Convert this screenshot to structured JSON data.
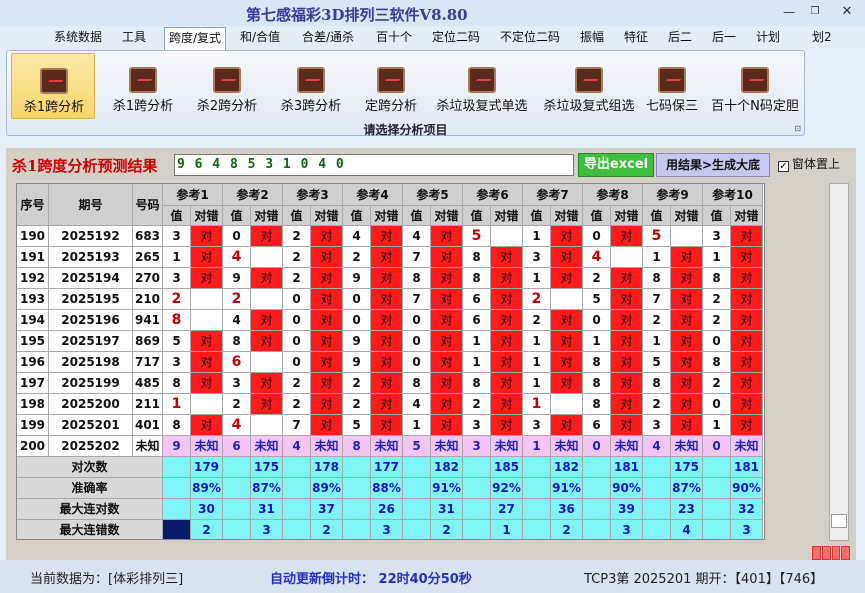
{
  "app": {
    "title": "第七感福彩3D排列三软件V8.80"
  },
  "menu": [
    "系统数据",
    "工具",
    "跨度/复式",
    "和/合值",
    "合差/通杀",
    "百十个",
    "定位二码",
    "不定位二码",
    "振幅",
    "特征",
    "后二",
    "后一",
    "计划",
    "划2"
  ],
  "menu_active": 2,
  "ribbon": {
    "tools": [
      "杀1跨分析",
      "杀1跨分析",
      "杀2跨分析",
      "杀3跨分析",
      "定跨分析",
      "杀垃圾复式单选",
      "杀垃圾复式组选",
      "七码保三",
      "百十个N码定胆"
    ],
    "selected": 0,
    "group_label": "请选择分析项目",
    "icon": "chart-icon"
  },
  "panel": {
    "heading": "杀1跨度分析预测结果",
    "result": "9 6 4 8 5 3 1 0 4 0",
    "export_button": "导出excel",
    "generate_button": "用结果>生成大底",
    "on_top_label": "窗体置上",
    "on_top_checked": true,
    "on_top_mark": "✓"
  },
  "table": {
    "col_seq": "序号",
    "col_period": "期号",
    "col_number": "号码",
    "refs": [
      "参考1",
      "参考2",
      "参考3",
      "参考4",
      "参考5",
      "参考6",
      "参考7",
      "参考8",
      "参考9",
      "参考10"
    ],
    "sub_val": "值",
    "sub_hit": "对错",
    "hit_text": "对",
    "rows": [
      {
        "seq": "190",
        "period": "2025192",
        "num": "683",
        "vals": [
          "3",
          "0",
          "2",
          "4",
          "4",
          "5",
          "1",
          "0",
          "5",
          "3"
        ],
        "hit": [
          1,
          1,
          1,
          1,
          1,
          0,
          1,
          1,
          0,
          1
        ]
      },
      {
        "seq": "191",
        "period": "2025193",
        "num": "265",
        "vals": [
          "1",
          "4",
          "2",
          "2",
          "7",
          "8",
          "3",
          "4",
          "1",
          "1"
        ],
        "hit": [
          1,
          0,
          1,
          1,
          1,
          1,
          1,
          0,
          1,
          1
        ]
      },
      {
        "seq": "192",
        "period": "2025194",
        "num": "270",
        "vals": [
          "3",
          "9",
          "2",
          "9",
          "8",
          "8",
          "1",
          "2",
          "8",
          "8"
        ],
        "hit": [
          1,
          1,
          1,
          1,
          1,
          1,
          1,
          1,
          1,
          1
        ]
      },
      {
        "seq": "193",
        "period": "2025195",
        "num": "210",
        "vals": [
          "2",
          "2",
          "0",
          "0",
          "7",
          "6",
          "2",
          "5",
          "7",
          "2"
        ],
        "hit": [
          0,
          0,
          1,
          1,
          1,
          1,
          0,
          1,
          1,
          1
        ]
      },
      {
        "seq": "194",
        "period": "2025196",
        "num": "941",
        "vals": [
          "8",
          "4",
          "0",
          "0",
          "0",
          "6",
          "2",
          "0",
          "2",
          "2"
        ],
        "hit": [
          0,
          1,
          1,
          1,
          1,
          1,
          1,
          1,
          1,
          1
        ]
      },
      {
        "seq": "195",
        "period": "2025197",
        "num": "869",
        "vals": [
          "5",
          "8",
          "0",
          "9",
          "0",
          "1",
          "1",
          "1",
          "1",
          "0"
        ],
        "hit": [
          1,
          1,
          1,
          1,
          1,
          1,
          1,
          1,
          1,
          1
        ]
      },
      {
        "seq": "196",
        "period": "2025198",
        "num": "717",
        "vals": [
          "3",
          "6",
          "0",
          "9",
          "0",
          "1",
          "1",
          "8",
          "5",
          "8"
        ],
        "hit": [
          1,
          0,
          1,
          1,
          1,
          1,
          1,
          1,
          1,
          1
        ]
      },
      {
        "seq": "197",
        "period": "2025199",
        "num": "485",
        "vals": [
          "8",
          "3",
          "2",
          "2",
          "8",
          "8",
          "1",
          "8",
          "8",
          "2"
        ],
        "hit": [
          1,
          1,
          1,
          1,
          1,
          1,
          1,
          1,
          1,
          1
        ]
      },
      {
        "seq": "198",
        "period": "2025200",
        "num": "211",
        "vals": [
          "1",
          "2",
          "2",
          "2",
          "4",
          "2",
          "1",
          "8",
          "2",
          "0"
        ],
        "hit": [
          0,
          1,
          1,
          1,
          1,
          1,
          0,
          1,
          1,
          1
        ]
      },
      {
        "seq": "199",
        "period": "2025201",
        "num": "401",
        "vals": [
          "8",
          "4",
          "7",
          "5",
          "1",
          "3",
          "3",
          "6",
          "3",
          "1"
        ],
        "hit": [
          1,
          0,
          1,
          1,
          1,
          1,
          1,
          1,
          1,
          1
        ]
      }
    ],
    "predict_row": {
      "seq": "200",
      "period": "2025202",
      "num": "未知",
      "vals": [
        "9",
        "6",
        "4",
        "8",
        "5",
        "3",
        "1",
        "0",
        "4",
        "0"
      ],
      "hit_text": "未知"
    },
    "stats": [
      {
        "label": "对次数",
        "values": [
          "179",
          "175",
          "178",
          "177",
          "182",
          "185",
          "182",
          "181",
          "175",
          "181"
        ]
      },
      {
        "label": "准确率",
        "values": [
          "89%",
          "87%",
          "89%",
          "88%",
          "91%",
          "92%",
          "91%",
          "90%",
          "87%",
          "90%"
        ]
      },
      {
        "label": "最大连对数",
        "values": [
          "30",
          "31",
          "37",
          "26",
          "31",
          "27",
          "36",
          "39",
          "23",
          "32"
        ]
      },
      {
        "label": "最大连错数",
        "values": [
          "2",
          "3",
          "2",
          "3",
          "2",
          "1",
          "2",
          "3",
          "4",
          "3"
        ]
      }
    ]
  },
  "status": {
    "current_data": "当前数据为：[体彩排列三]",
    "countdown": "自动更新倒计时：  22时40分50秒",
    "latest": "TCP3第 2025201 期开：【401】【746】"
  }
}
